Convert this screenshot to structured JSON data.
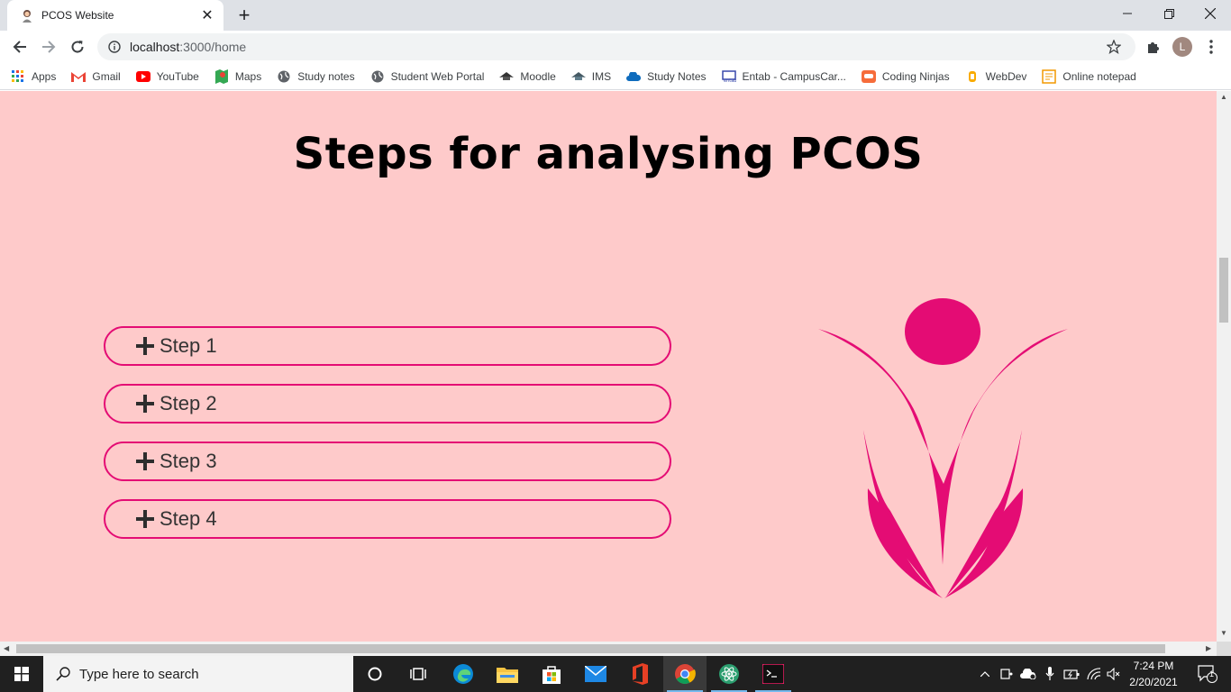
{
  "browser": {
    "tab_title": "PCOS Website",
    "url_host": "localhost",
    "url_rest": ":3000/home",
    "profile_initial": "L"
  },
  "bookmarks": [
    {
      "label": "Apps",
      "icon": "apps-grid-icon"
    },
    {
      "label": "Gmail",
      "icon": "gmail-icon"
    },
    {
      "label": "YouTube",
      "icon": "youtube-icon"
    },
    {
      "label": "Maps",
      "icon": "maps-icon"
    },
    {
      "label": "Study notes",
      "icon": "globe-icon"
    },
    {
      "label": "Student Web Portal",
      "icon": "globe-icon"
    },
    {
      "label": "Moodle",
      "icon": "moodle-icon"
    },
    {
      "label": "IMS",
      "icon": "ims-icon"
    },
    {
      "label": "Study Notes",
      "icon": "cloud-icon"
    },
    {
      "label": "Entab - CampusCar...",
      "icon": "entab-icon"
    },
    {
      "label": "Coding Ninjas",
      "icon": "coding-ninjas-icon"
    },
    {
      "label": "WebDev",
      "icon": "webdev-icon"
    },
    {
      "label": "Online notepad",
      "icon": "notepad-icon"
    }
  ],
  "page": {
    "heading": "Steps for analysing PCOS",
    "steps": [
      "Step 1",
      "Step 2",
      "Step 3",
      "Step 4"
    ],
    "accent_color": "#e40c74",
    "background_color": "#fecaca"
  },
  "taskbar": {
    "search_placeholder": "Type here to search",
    "time": "7:24 PM",
    "date": "2/20/2021",
    "notification_count": "1"
  }
}
